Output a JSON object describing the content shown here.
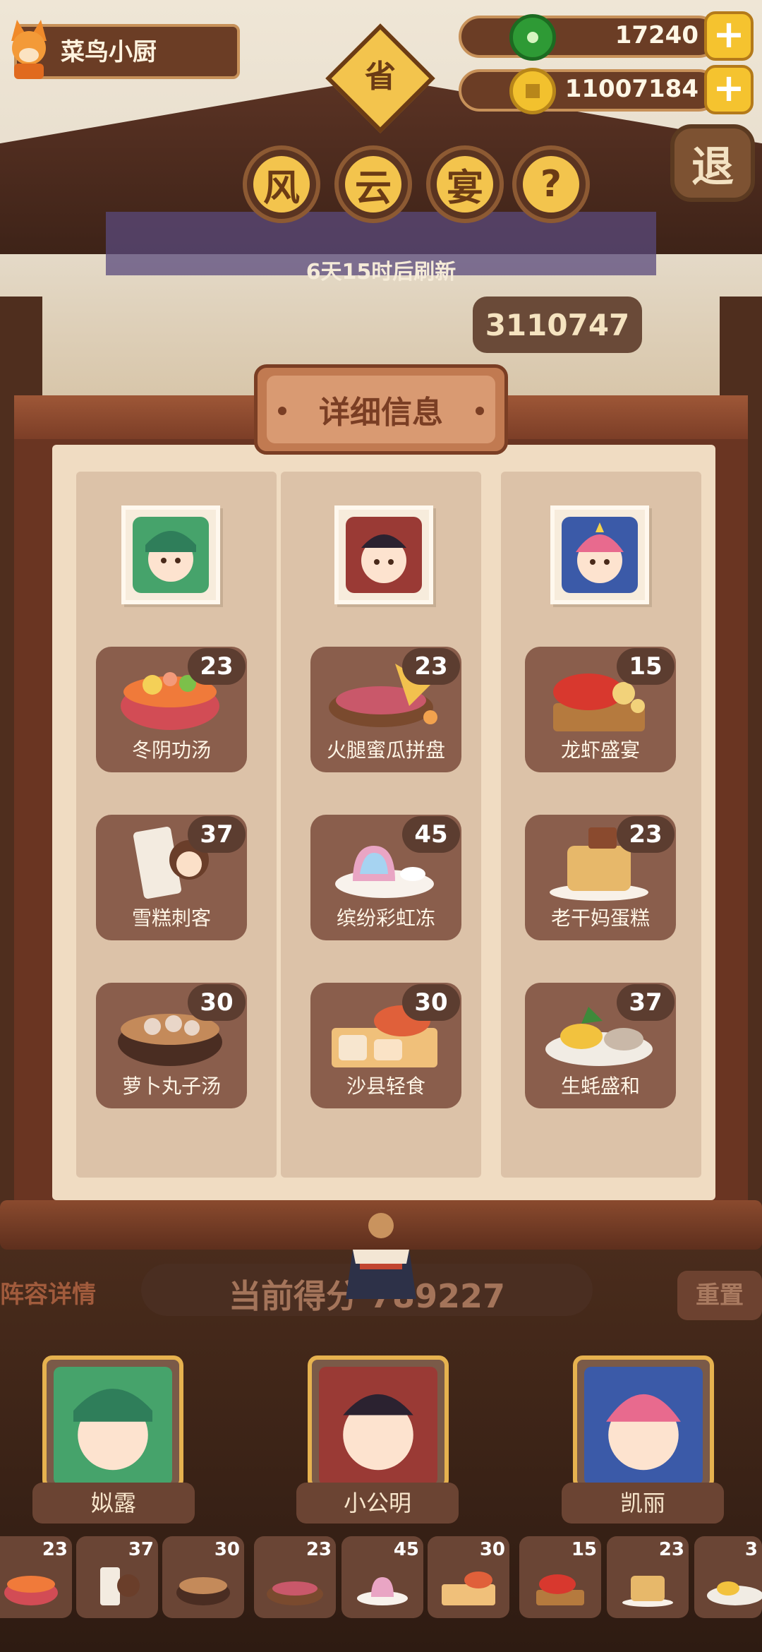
{
  "player": {
    "name": "菜鸟小厨"
  },
  "currency": {
    "jade": "17240",
    "coins": "11007184",
    "plus_symbol": "+"
  },
  "header": {
    "province_badge": "省",
    "title_chars": [
      "风",
      "云",
      "宴"
    ],
    "help_symbol": "?",
    "exit_label": "退",
    "refresh_text": "6天15时后刷新",
    "score_top": "3110747"
  },
  "dialog": {
    "title": "详细信息",
    "columns": [
      {
        "chef_name": "姒露",
        "dishes": [
          {
            "name": "冬阴功汤",
            "count": "23"
          },
          {
            "name": "雪糕刺客",
            "count": "37"
          },
          {
            "name": "萝卜丸子汤",
            "count": "30"
          }
        ]
      },
      {
        "chef_name": "小公明",
        "dishes": [
          {
            "name": "火腿蜜瓜拼盘",
            "count": "23"
          },
          {
            "name": "缤纷彩虹冻",
            "count": "45"
          },
          {
            "name": "沙县轻食",
            "count": "30"
          }
        ]
      },
      {
        "chef_name": "凯丽",
        "dishes": [
          {
            "name": "龙虾盛宴",
            "count": "15"
          },
          {
            "name": "老干妈蛋糕",
            "count": "23"
          },
          {
            "name": "生蚝盛和",
            "count": "37"
          }
        ]
      }
    ]
  },
  "lower": {
    "lineup_label": "阵容详情",
    "current_score_label": "当前得分",
    "current_score_value": "789227",
    "reset_label": "重置",
    "chefs": [
      {
        "name": "姒露"
      },
      {
        "name": "小公明"
      },
      {
        "name": "凯丽"
      }
    ],
    "dish_strip": [
      "23",
      "37",
      "30",
      "23",
      "45",
      "30",
      "15",
      "23",
      "3"
    ]
  },
  "colors": {
    "jade": "#2e9a35",
    "coin": "#f2c12e",
    "accent": "#f5c32f",
    "frame": "#6a3522"
  }
}
